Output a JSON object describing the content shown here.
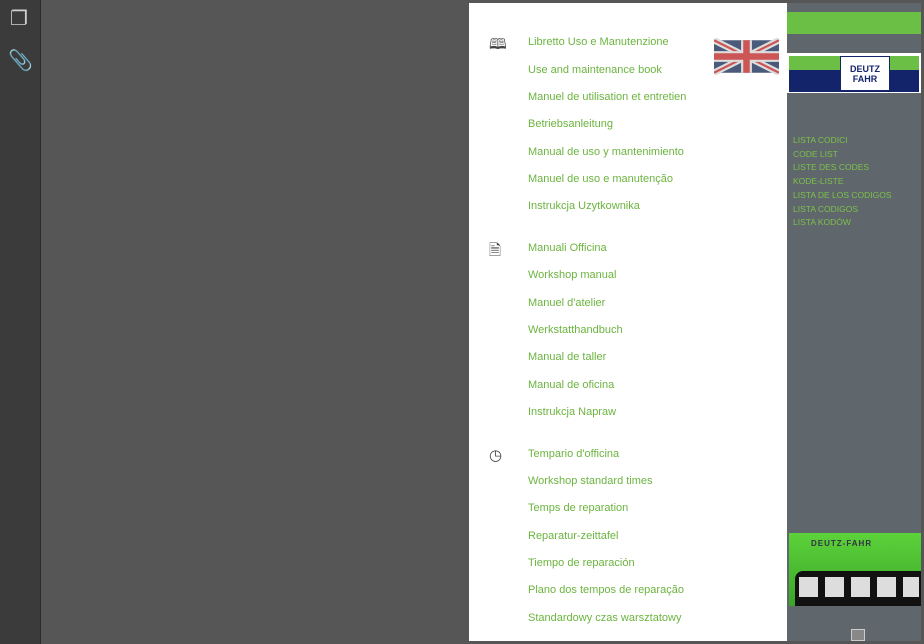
{
  "sidebar": {
    "icons": [
      "pages-icon",
      "attachment-icon"
    ]
  },
  "sections": [
    {
      "icon": "book-icon",
      "items": [
        "Libretto Uso e Manutenzione",
        "Use and maintenance book",
        "Manuel de utilisation et entretien",
        "Betriebsanleitung",
        "Manual de uso y mantenimiento",
        " Manuel de uso e manutenção",
        "Instrukcja Uzytkownika"
      ]
    },
    {
      "icon": "document-icon",
      "items": [
        "Manuali Officina",
        "Workshop manual",
        "Manuel d'atelier",
        "Werkstatthandbuch",
        "Manual de taller",
        "Manual de oficina",
        "Instrukcja Napraw"
      ]
    },
    {
      "icon": "clock-icon",
      "items": [
        "Tempario d'officina",
        "Workshop standard times",
        "Temps de reparation",
        "Reparatur-zeittafel",
        "Tiempo de reparación",
        "Plano dos tempos de reparação",
        "Standardowy czas warsztatowy"
      ]
    }
  ],
  "logo": {
    "line1": "DEUTZ",
    "line2": "FAHR"
  },
  "code_list": [
    "LISTA CODICI",
    "CODE LIST",
    "LISTE DES CODES",
    "KODE-LISTE",
    "LISTA DE LOS CODIGOS",
    " LISTA  CODIGOS",
    "LISTA KODÓW"
  ],
  "tractor_brand": "DEUTZ-FAHR",
  "colors": {
    "accent": "#6cb43f",
    "panel": "#5f666c",
    "navy": "#14246b"
  }
}
